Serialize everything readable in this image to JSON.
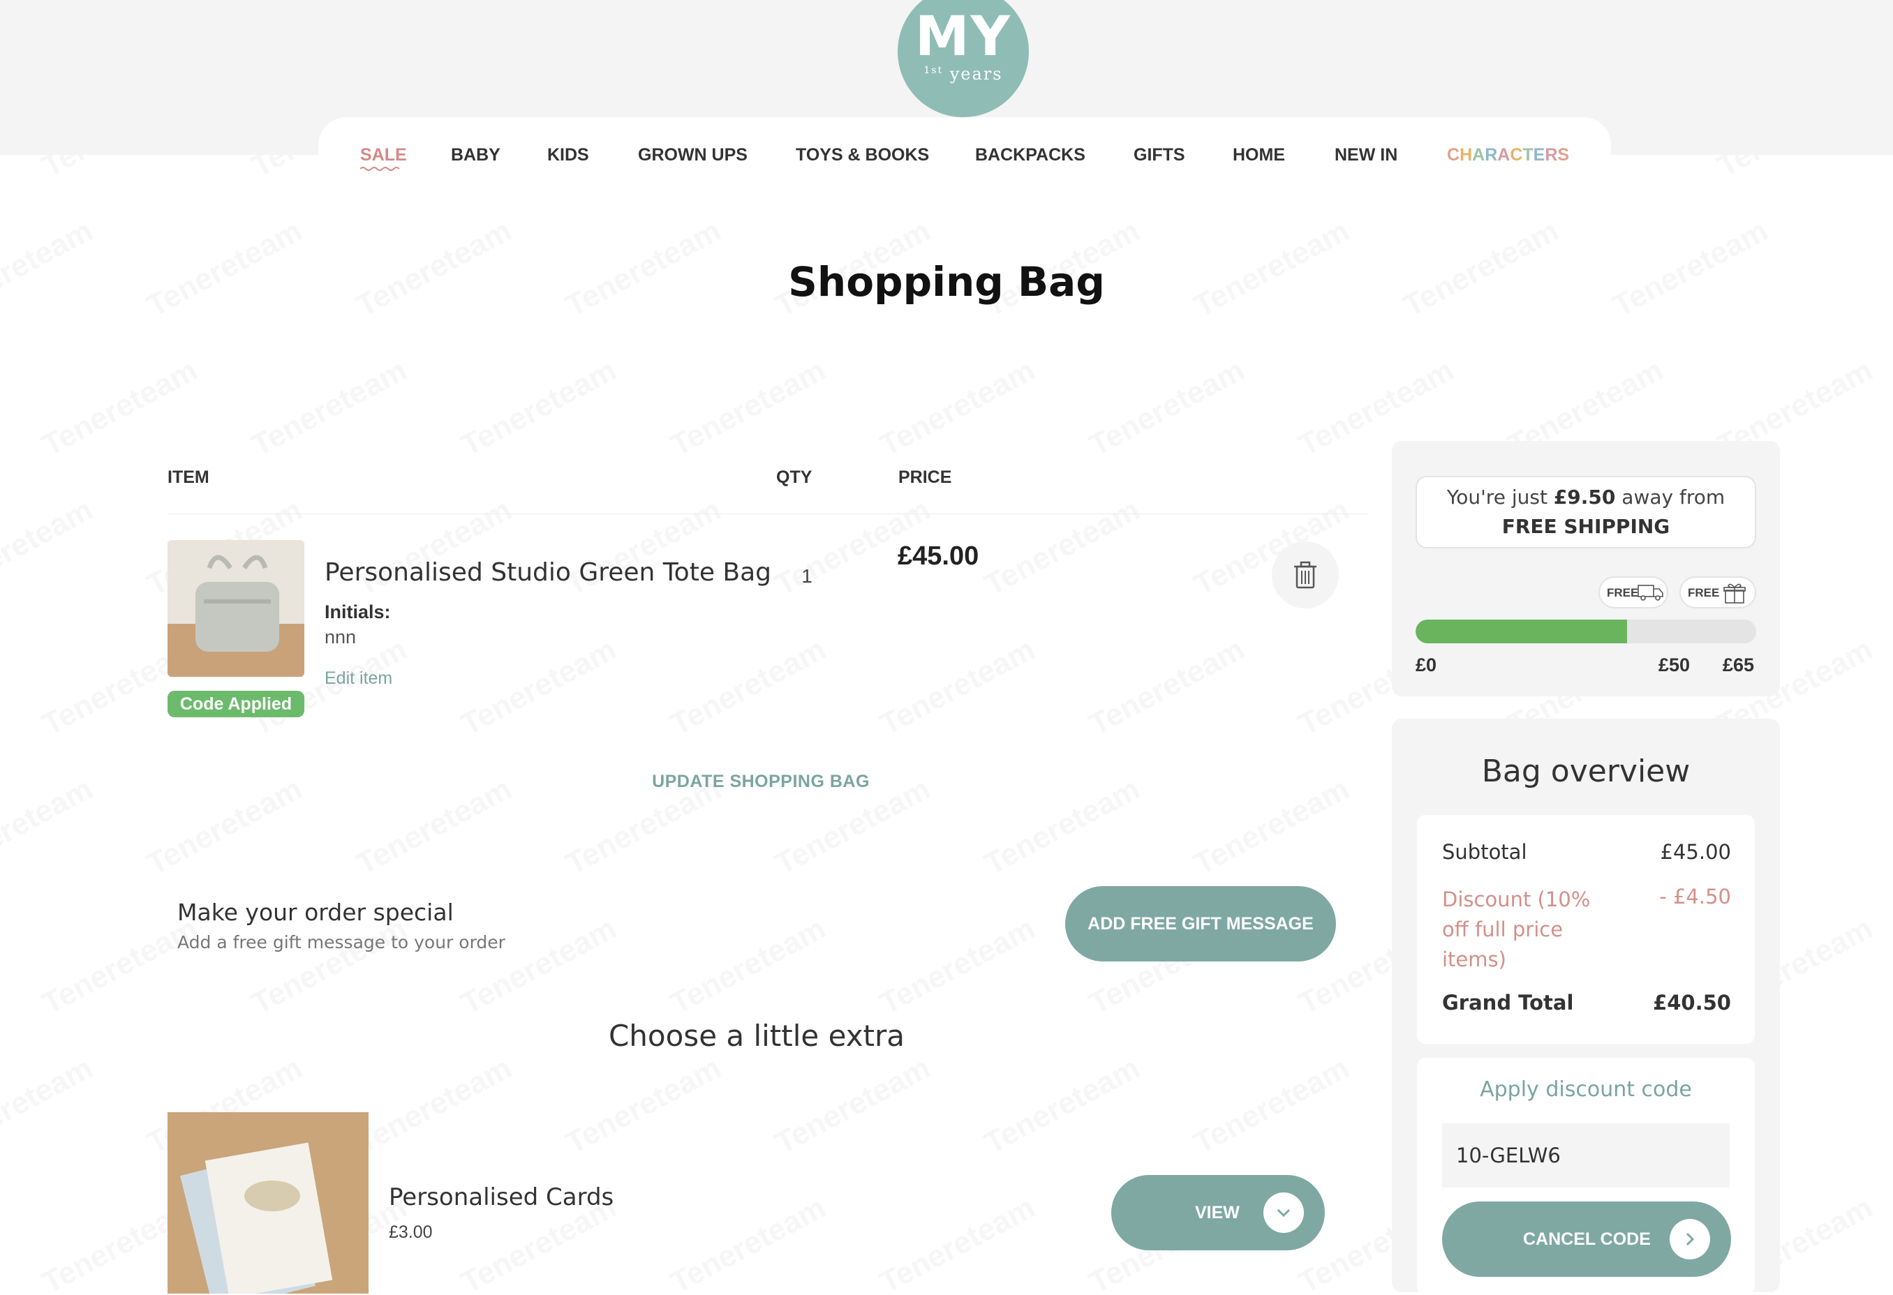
{
  "brand": {
    "logo_main": "MY",
    "logo_sub_sup": "1st",
    "logo_sub": "years",
    "primary_color": "#7fa8a3"
  },
  "nav": {
    "items": [
      "SALE",
      "BABY",
      "KIDS",
      "GROWN UPS",
      "TOYS & BOOKS",
      "BACKPACKS",
      "GIFTS",
      "HOME",
      "NEW IN"
    ],
    "characters_letters": [
      "C",
      "H",
      "A",
      "R",
      "A",
      "C",
      "T",
      "E",
      "R",
      "S"
    ],
    "characters_colors": [
      "#e0a08c",
      "#e6b36a",
      "#9cc3a8",
      "#8fb7c9",
      "#d79aa2",
      "#e6b36a",
      "#9cc3a8",
      "#8fb7c9",
      "#d79aa2",
      "#e0a08c"
    ]
  },
  "page": {
    "title": "Shopping Bag"
  },
  "table": {
    "headers": {
      "item": "ITEM",
      "qty": "QTY",
      "price": "PRICE"
    }
  },
  "cart_item": {
    "name": "Personalised Studio Green Tote Bag",
    "option_label": "Initials:",
    "option_value": "nnn",
    "edit_label": "Edit item",
    "badge": "Code Applied",
    "qty": "1",
    "price": "£45.00",
    "delete_icon": "trash-icon"
  },
  "update_label": "UPDATE SHOPPING BAG",
  "gift": {
    "title": "Make your order special",
    "subtitle": "Add a free gift message to your order",
    "button": "ADD FREE GIFT MESSAGE"
  },
  "extras": {
    "title": "Choose a little extra",
    "items": [
      {
        "name": "Personalised Cards",
        "price": "£3.00",
        "button": "VIEW",
        "icon": "chevron-down-icon"
      }
    ]
  },
  "shipping": {
    "msg_pre": "You're just ",
    "msg_amount": "£9.50",
    "msg_mid": " away from ",
    "msg_strong": "FREE SHIPPING",
    "badge_shipping": "FREE",
    "badge_gift": "FREE",
    "progress_fraction": 0.62,
    "ticks": [
      "£0",
      "£50",
      "£65"
    ]
  },
  "overview": {
    "title": "Bag overview",
    "subtotal_label": "Subtotal",
    "subtotal_value": "£45.00",
    "discount_label": "Discount (10% off full price items)",
    "discount_value": "- £4.50",
    "grand_total_label": "Grand Total",
    "grand_total_value": "£40.50"
  },
  "discount": {
    "title": "Apply discount code",
    "code_value": "10-GELW6",
    "cancel_button": "CANCEL CODE",
    "cancel_icon": "chevron-right-icon"
  }
}
